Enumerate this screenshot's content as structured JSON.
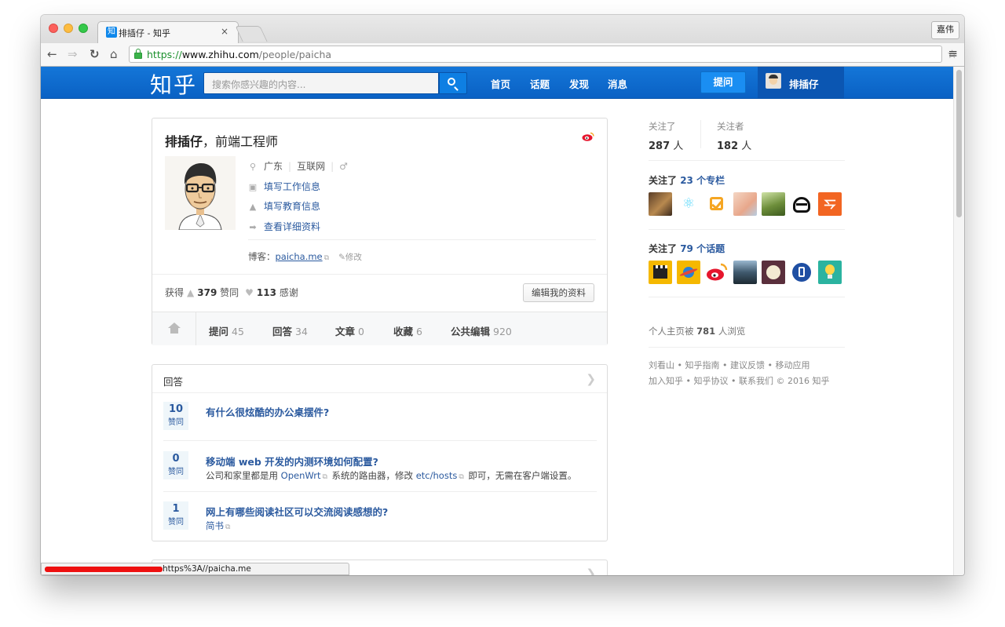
{
  "browser": {
    "tab_favicon": "知",
    "tab_title": "排插仔 - 知乎",
    "tab_close": "×",
    "profile_button": "嘉伟",
    "url_scheme": "https://",
    "url_host": "www.zhihu.com",
    "url_path": "/people/paicha",
    "status_url": "https%3A//paicha.me"
  },
  "topbar": {
    "logo": "知乎",
    "search_placeholder": "搜索你感兴趣的内容...",
    "nav": [
      "首页",
      "话题",
      "发现",
      "消息"
    ],
    "ask_button": "提问",
    "user_name": "排插仔"
  },
  "profile": {
    "name": "排插仔",
    "headline": "，前端工程师",
    "location": "广东",
    "industry": "互联网",
    "gender_icon": "♂",
    "work_link": "填写工作信息",
    "edu_link": "填写教育信息",
    "detail_link": "查看详细资料",
    "blog_label": "博客：",
    "blog_link": "paicha.me",
    "blog_edit": "修改",
    "gained_label": "获得",
    "agree_count": "379",
    "agree_label": "赞同",
    "thanks_count": "113",
    "thanks_label": "感谢",
    "edit_profile_button": "编辑我的资料",
    "tabs": [
      {
        "label": "提问",
        "count": "45"
      },
      {
        "label": "回答",
        "count": "34"
      },
      {
        "label": "文章",
        "count": "0"
      },
      {
        "label": "收藏",
        "count": "6"
      },
      {
        "label": "公共编辑",
        "count": "920"
      }
    ]
  },
  "answers": {
    "title": "回答",
    "vote_label": "赞同",
    "items": [
      {
        "votes": "10",
        "question": "有什么很炫酷的办公桌摆件?"
      },
      {
        "votes": "0",
        "question": "移动端 web 开发的内测环境如何配置?",
        "excerpt_a": "公司和家里都是用 ",
        "excerpt_link1": "OpenWrt",
        "excerpt_b": " 系统的路由器，修改 ",
        "excerpt_link2": "etc/hosts",
        "excerpt_c": " 即可，无需在客户端设置。"
      },
      {
        "votes": "1",
        "question": "网上有哪些阅读社区可以交流阅读感想的?",
        "excerpt_link1": "简书"
      }
    ]
  },
  "sidebar": {
    "following_label": "关注了",
    "following_count": "287",
    "followers_label": "关注者",
    "followers_count": "182",
    "people_unit": "人",
    "columns_prefix": "关注了 ",
    "columns_count": "23 个专栏",
    "topics_prefix": "关注了 ",
    "topics_count": "79 个话题",
    "visits_prefix": "个人主页被 ",
    "visits_count": "781",
    "visits_suffix": " 人浏览",
    "footer_line1": "刘看山 • 知乎指南 • 建议反馈 • 移动应用",
    "footer_line2": "加入知乎 • 知乎协议 • 联系我们 © 2016 知乎"
  },
  "colors": {
    "brand_blue": "#0f63c9",
    "link_blue": "#2b5a9f"
  }
}
